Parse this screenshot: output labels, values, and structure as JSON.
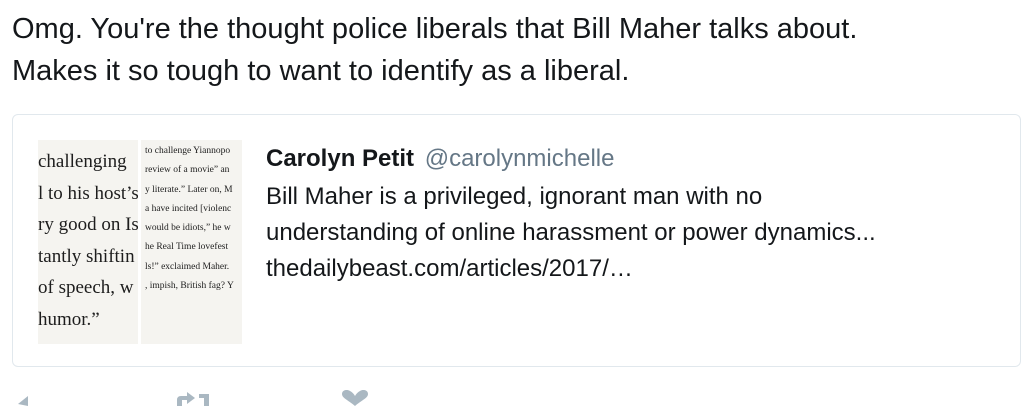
{
  "tweet": {
    "text_lines": [
      "Omg. You're the thought police liberals that Bill Maher talks about.",
      "Makes it so tough to want to identify as a liberal."
    ]
  },
  "quoted_tweet": {
    "name": "Carolyn Petit",
    "handle": "@carolynmichelle",
    "text_lines": [
      "Bill Maher is a privileged, ignorant man with no",
      "understanding of online harassment or power dynamics...",
      "thedailybeast.com/articles/2017/…"
    ],
    "thumbnail": {
      "left_lines": [
        "challenging",
        "l to his host’s",
        "ry good on Is",
        "tantly shiftin",
        "of speech, w",
        "humor.”"
      ],
      "right_lines": [
        "to challenge Yiannopo",
        "review of a movie” an",
        "y literate.” Later on, M",
        "a have incited [violenc",
        "would be idiots,” he w",
        "he Real Time lovefest",
        "",
        "ls!” exclaimed Maher.",
        ", impish, British fag? Y"
      ]
    }
  },
  "actions": {
    "reply_icon": "reply-icon",
    "retweet_icon": "retweet-icon",
    "like_icon": "heart-icon",
    "color": "#aab8c2"
  }
}
